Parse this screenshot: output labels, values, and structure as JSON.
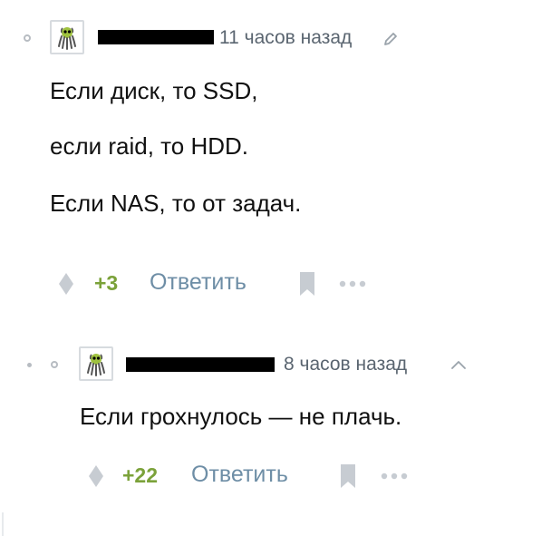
{
  "comments": [
    {
      "timestamp": "11 часов назад",
      "text": [
        "Если диск, то SSD,",
        "если raid, то HDD.",
        "Если NAS, то от задач."
      ],
      "rating": "+3",
      "reply_label": "Ответить",
      "icons": {
        "avatar": "octopus-avatar-icon",
        "edit": "pencil-icon",
        "vote": "diamond-vote-icon",
        "save": "bookmark-icon",
        "more": "more-dots-icon"
      }
    },
    {
      "timestamp": "8 часов назад",
      "text": [
        "Если грохнулось — не плачь."
      ],
      "rating": "+22",
      "reply_label": "Ответить",
      "icons": {
        "avatar": "octopus-avatar-icon",
        "collapse": "chevron-up-icon",
        "vote": "diamond-vote-icon",
        "save": "bookmark-icon",
        "more": "more-dots-icon"
      }
    }
  ],
  "colors": {
    "rating": "#7ba23a",
    "reply": "#6e8ea6",
    "meta": "#5a6570",
    "icon_gray": "#c7ccd2"
  }
}
